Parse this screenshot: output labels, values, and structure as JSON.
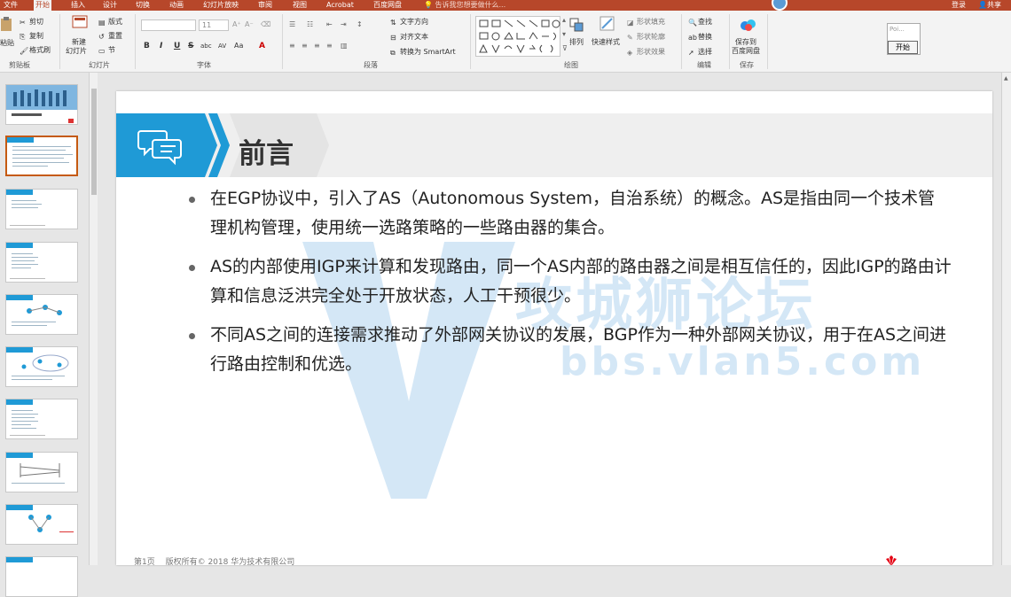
{
  "tabs": [
    "文件",
    "开始",
    "插入",
    "设计",
    "切换",
    "动画",
    "幻灯片放映",
    "审阅",
    "视图",
    "Acrobat",
    "百度网盘"
  ],
  "active_tab": "开始",
  "tell_me": "告诉我您想要做什么...",
  "login": "登录",
  "share": "共享",
  "ribbon": {
    "clipboard": {
      "paste": "粘贴",
      "cut": "剪切",
      "copy": "复制",
      "format_painter": "格式刷",
      "label": "剪贴板"
    },
    "slides": {
      "new_slide_line1": "新建",
      "new_slide_line2": "幻灯片",
      "layout": "版式",
      "reset": "重置",
      "section": "节",
      "label": "幻灯片"
    },
    "font": {
      "size": "11",
      "label": "字体",
      "bold": "B",
      "italic": "I",
      "underline": "U",
      "strike": "S",
      "shadow": "abc",
      "spacing": "AV",
      "case": "Aa",
      "color": "A"
    },
    "paragraph": {
      "text_direction": "文字方向",
      "align_text": "对齐文本",
      "smartart": "转换为 SmartArt",
      "label": "段落"
    },
    "drawing": {
      "arrange": "排列",
      "quick_styles": "快速样式",
      "shape_fill": "形状填充",
      "shape_outline": "形状轮廓",
      "shape_effects": "形状效果",
      "label": "绘图"
    },
    "editing": {
      "find": "查找",
      "replace": "替换",
      "select": "选择",
      "label": "编辑"
    },
    "save": {
      "save_to_line1": "保存到",
      "save_to_line2": "百度网盘",
      "label": "保存"
    }
  },
  "popup": {
    "hint": "Poi...",
    "start_button": "开始"
  },
  "thumbnails": [
    {
      "num": "",
      "selected": false
    },
    {
      "num": "",
      "selected": true
    },
    {
      "num": "",
      "selected": false
    },
    {
      "num": "",
      "selected": false
    },
    {
      "num": "",
      "selected": false
    },
    {
      "num": "",
      "selected": false
    },
    {
      "num": "",
      "selected": false
    },
    {
      "num": "",
      "selected": false
    },
    {
      "num": "",
      "selected": false
    }
  ],
  "slide": {
    "title": "前言",
    "bullets": [
      "在EGP协议中，引入了AS（Autonomous System，自治系统）的概念。AS是指由同一个技术管理机构管理，使用统一选路策略的一些路由器的集合。",
      "AS的内部使用IGP来计算和发现路由，同一个AS内部的路由器之间是相互信任的，因此IGP的路由计算和信息泛洪完全处于开放状态，人工干预很少。",
      "不同AS之间的连接需求推动了外部网关协议的发展，BGP作为一种外部网关协议，用于在AS之间进行路由控制和优选。"
    ],
    "watermark_line1": "攻城狮论坛",
    "watermark_line2": "bbs.vlan5.com",
    "footer": "第1页 　版权所有© 2018 华为技术有限公司"
  },
  "colors": {
    "accent": "#b7472a",
    "header_blue": "#1f9ad6",
    "watermark": "#1a7fd0"
  }
}
